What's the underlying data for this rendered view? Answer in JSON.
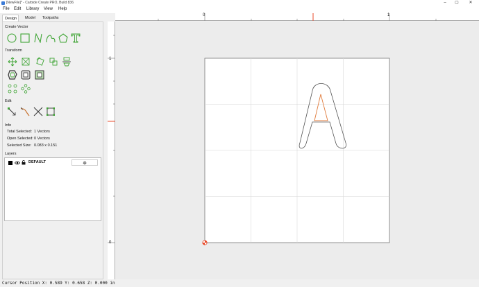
{
  "window": {
    "title": "[NewFile]* - Carbide Create PRO, Build 836",
    "controls": [
      "–",
      "▢",
      "✕"
    ]
  },
  "menu": [
    "File",
    "Edit",
    "Library",
    "View",
    "Help"
  ],
  "tabs": [
    "Design",
    "Model",
    "Toolpaths"
  ],
  "sections": {
    "create_vector": "Create Vector",
    "transform": "Transform",
    "edit": "Edit",
    "info": "Info",
    "layers": "Layers"
  },
  "icons": {
    "create_vector": [
      "circle-icon",
      "rectangle-icon",
      "polyline-icon",
      "curve-icon",
      "polygon-icon",
      "text-icon"
    ],
    "transform_row1": [
      "move-icon",
      "scale-icon",
      "rotate-icon",
      "align-icon",
      "mirror-icon"
    ],
    "transform_row2": [
      "offset-icon",
      "boolean-join-icon",
      "boolean-subtract-icon"
    ],
    "transform_row3": [
      "circular-array-icon",
      "linear-array-icon"
    ],
    "edit": [
      "node-edit-icon",
      "trim-icon",
      "cut-icon",
      "bounding-box-icon"
    ]
  },
  "info": {
    "rows": [
      {
        "label": "Total Selected:",
        "value": "1 Vectors"
      },
      {
        "label": "Open Selected:",
        "value": "0 Vectors"
      },
      {
        "label": "Selected Size:",
        "value": "0.083 x 0.151"
      }
    ]
  },
  "layers": [
    {
      "name": "DEFAULT",
      "color": "#000000",
      "settings_icon": "gear-icon"
    }
  ],
  "rulers": {
    "top_labels": [
      "0",
      "1"
    ],
    "left_labels": [
      "1",
      "0"
    ]
  },
  "colors": {
    "accent_green": "#3fa535",
    "cursor_marker": "#e84a2a",
    "selection": "#e07a3a"
  },
  "status": {
    "text": "Cursor Position X: 0.589 Y: 0.658 Z: 0.000 in"
  }
}
